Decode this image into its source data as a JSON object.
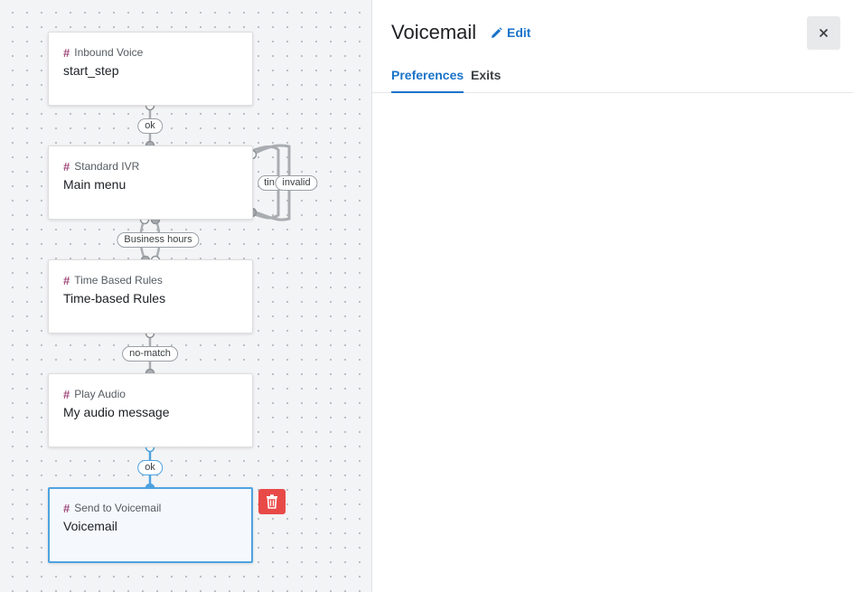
{
  "flow": {
    "nodes": [
      {
        "type": "Inbound Voice",
        "name": "start_step"
      },
      {
        "type": "Standard IVR",
        "name": "Main menu"
      },
      {
        "type": "Time Based Rules",
        "name": "Time-based Rules"
      },
      {
        "type": "Play Audio",
        "name": "My audio message"
      },
      {
        "type": "Send to Voicemail",
        "name": "Voicemail"
      }
    ],
    "edge_labels": {
      "ok_1": "ok",
      "timeout_partial": "tin",
      "invalid": "invalid",
      "business_hours": "Business hours",
      "no_match": "no-match",
      "ok_2": "ok"
    }
  },
  "panel": {
    "title": "Voicemail",
    "edit_label": "Edit",
    "tabs": [
      {
        "label": "Preferences",
        "active": true
      },
      {
        "label": "Exits",
        "active": false
      }
    ]
  },
  "colors": {
    "accent": "#1a73c9",
    "selected_border": "#4ea3e0",
    "delete": "#e84a48",
    "node_type_hash": "#a04a7a"
  },
  "icons": {
    "edit": "pencil-icon",
    "close": "close-icon",
    "delete": "trash-icon"
  }
}
